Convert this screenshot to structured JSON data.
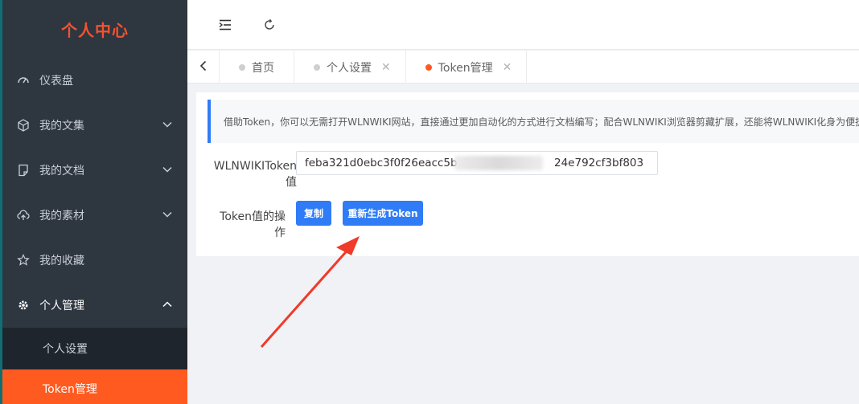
{
  "sidebar": {
    "title": "个人中心",
    "items": [
      {
        "label": "仪表盘",
        "icon": "dashboard-icon"
      },
      {
        "label": "我的文集",
        "icon": "cube-icon"
      },
      {
        "label": "我的文档",
        "icon": "document-icon"
      },
      {
        "label": "我的素材",
        "icon": "cloud-upload-icon"
      },
      {
        "label": "我的收藏",
        "icon": "star-icon"
      },
      {
        "label": "个人管理",
        "icon": "gear-icon"
      }
    ],
    "submenu": [
      {
        "label": "个人设置"
      },
      {
        "label": "Token管理"
      }
    ]
  },
  "header": {
    "icons": [
      "indent-icon",
      "refresh-icon"
    ]
  },
  "tabs": [
    {
      "label": "首页"
    },
    {
      "label": "个人设置"
    },
    {
      "label": "Token管理"
    }
  ],
  "main": {
    "notice": "借助Token，你可以无需打开WLNWIKI网站，直接通过更加自动化的方式进行文档编写；配合WLNWIKI浏览器剪藏扩展，还能将WLNWIKI化身为便捷",
    "token_label_line1": "WLNWIKIToken",
    "token_label_line2": "值",
    "token_value_start": "feba321d0ebc3f0f26eacc5bc9",
    "token_value_end": "24e792cf3bf803",
    "ops_label_line1": "Token值的操",
    "ops_label_line2": "作",
    "copy_button": "复制",
    "regenerate_button": "重新生成Token"
  },
  "colors": {
    "accent": "#ff5a1f",
    "primary": "#2f7cf6",
    "sidebar_bg": "#2e3640",
    "annotation_arrow": "#f03a2a"
  }
}
